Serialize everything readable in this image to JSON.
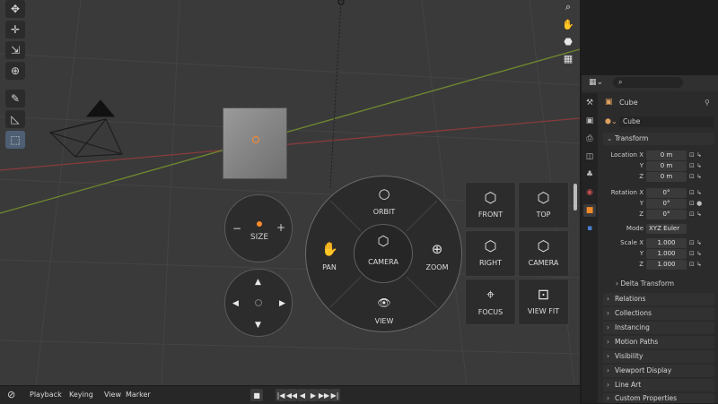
{
  "viewport": {
    "tools": [
      "cursor-icon",
      "crosshair-icon",
      "scale-icon",
      "transform-icon",
      "annotate-icon",
      "measure-icon",
      "add-cube-icon"
    ],
    "nav_icons": [
      "zoom-icon",
      "hand-icon",
      "camera-icon",
      "grid-icon"
    ]
  },
  "size_control": {
    "minus": "−",
    "plus": "+",
    "label": "SIZE"
  },
  "direction_pad": {
    "up": "▲",
    "down": "▼",
    "left": "◀",
    "right": "▶"
  },
  "pie_menu": {
    "orbit": "ORBIT",
    "pan": "PAN",
    "zoom": "ZOOM",
    "camera": "CAMERA",
    "view": "VIEW",
    "orbit_icon": "○",
    "pan_icon": "✋",
    "zoom_icon": "⊕",
    "camera_icon": "⬡",
    "view_icon": "👁"
  },
  "view_buttons": [
    {
      "label": "FRONT",
      "icon": "⬡"
    },
    {
      "label": "TOP",
      "icon": "⬡"
    },
    {
      "label": "RIGHT",
      "icon": "⬡"
    },
    {
      "label": "CAMERA",
      "icon": "⬡"
    },
    {
      "label": "FOCUS",
      "icon": "⌖"
    },
    {
      "label": "VIEW FIT",
      "icon": "⊡"
    }
  ],
  "timeline": {
    "editor_icon": "⊘",
    "playback": "Playback",
    "keying": "Keying",
    "view": "View",
    "marker": "Marker",
    "stop": "■",
    "jump_start": "|◀",
    "prev_key": "◀◀",
    "play_rev": "◀",
    "play": "▶",
    "next_key": "▶▶",
    "jump_end": "▶|"
  },
  "properties": {
    "search_placeholder": "",
    "object_name": "Cube",
    "mesh_name": "Cube",
    "transform": "Transform",
    "location_label": "Location X",
    "location": [
      "0 m",
      "0 m",
      "0 m"
    ],
    "rotation_label": "Rotation X",
    "rotation": [
      "0°",
      "0°",
      "0°"
    ],
    "mode_label": "Mode",
    "mode_value": "XYZ Euler",
    "scale_label": "Scale X",
    "scale": [
      "1.000",
      "1.000",
      "1.000"
    ],
    "y": "Y",
    "z": "Z",
    "delta": "Delta Transform",
    "sections": [
      "Relations",
      "Collections",
      "Instancing",
      "Motion Paths",
      "Visibility",
      "Viewport Display",
      "Line Art",
      "Custom Properties"
    ]
  },
  "colors": {
    "accent": "#ff8a2a",
    "panel": "#2b2b2b",
    "viewport": "#3a3a3a"
  }
}
